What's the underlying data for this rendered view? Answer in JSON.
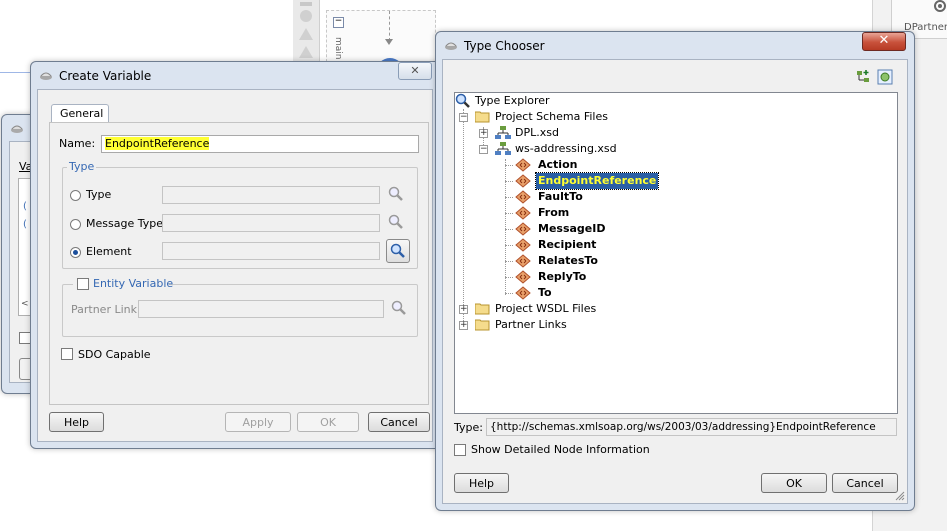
{
  "background": {
    "canvas_label": "main",
    "right_panel_label": "DPartner"
  },
  "back_dialog": {
    "label_fragment": "Va"
  },
  "create_variable": {
    "title": "Create Variable",
    "tab_general": "General",
    "name_label": "Name:",
    "name_value": "EndpointReference",
    "type_group_label": "Type",
    "radio_type": "Type",
    "radio_message_type": "Message Type",
    "radio_element": "Element",
    "selected_radio": "Element",
    "entity_variable_label": "Entity Variable",
    "partner_link_label": "Partner Link:",
    "sdo_capable_label": "SDO Capable",
    "help_button": "Help",
    "apply_button": "Apply",
    "ok_button": "OK",
    "cancel_button": "Cancel"
  },
  "type_chooser": {
    "title": "Type Chooser",
    "close_glyph": "✕",
    "tree": {
      "root": "Type Explorer",
      "project_schema_files": "Project Schema Files",
      "dpl_xsd": "DPL.xsd",
      "ws_addressing_xsd": "ws-addressing.xsd",
      "elements": [
        "Action",
        "EndpointReference",
        "FaultTo",
        "From",
        "MessageID",
        "Recipient",
        "RelatesTo",
        "ReplyTo",
        "To"
      ],
      "selected_element": "EndpointReference",
      "project_wsdl_files": "Project WSDL Files",
      "partner_links": "Partner Links"
    },
    "type_label": "Type:",
    "type_value": "{http://schemas.xmlsoap.org/ws/2003/03/addressing}EndpointReference",
    "show_detailed_label": "Show Detailed Node Information",
    "help_button": "Help",
    "ok_button": "OK",
    "cancel_button": "Cancel"
  },
  "colors": {
    "window_frame": "#dbe4f0",
    "selection": "#2a5fa5",
    "highlight": "#ffff33",
    "group_label": "#3568b3"
  }
}
